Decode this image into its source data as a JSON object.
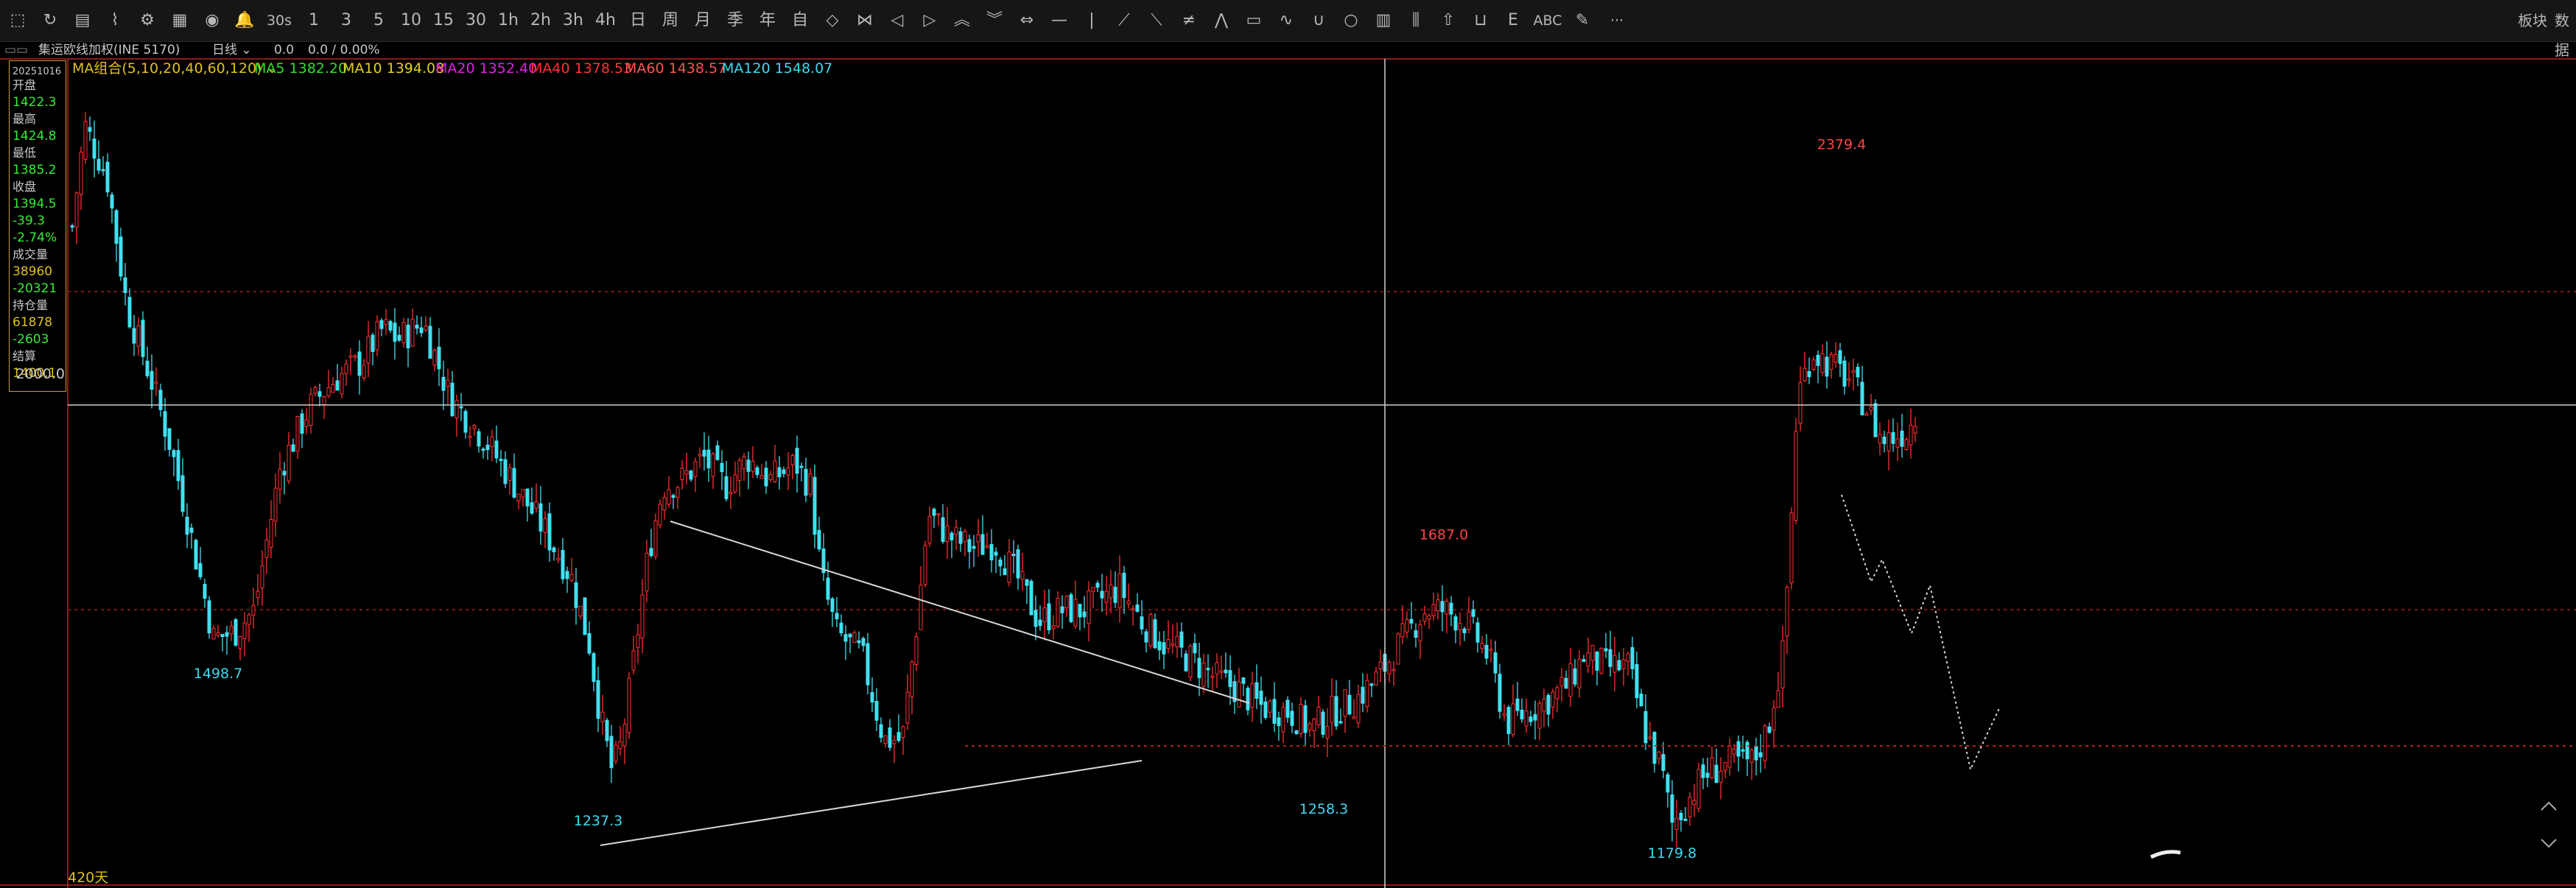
{
  "toolbar": {
    "left_items": [
      {
        "label": "⬚",
        "name": "draw-rect-icon"
      },
      {
        "label": "↻",
        "name": "refresh-icon"
      },
      {
        "label": "▤",
        "name": "list-icon"
      },
      {
        "label": "⌇",
        "name": "line-chart-icon"
      },
      {
        "label": "⚙",
        "name": "indicator-icon"
      },
      {
        "label": "▦",
        "name": "panel-icon"
      },
      {
        "label": "◉",
        "name": "overlay-icon"
      },
      {
        "label": "🔔",
        "name": "bell-icon"
      },
      {
        "label": "30s",
        "name": "period-30s"
      },
      {
        "label": "1",
        "name": "period-1m"
      },
      {
        "label": "3",
        "name": "period-3m"
      },
      {
        "label": "5",
        "name": "period-5m"
      },
      {
        "label": "10",
        "name": "period-10m"
      },
      {
        "label": "15",
        "name": "period-15m"
      },
      {
        "label": "30",
        "name": "period-30m"
      },
      {
        "label": "1h",
        "name": "period-1h"
      },
      {
        "label": "2h",
        "name": "period-2h"
      },
      {
        "label": "3h",
        "name": "period-3h"
      },
      {
        "label": "4h",
        "name": "period-4h"
      },
      {
        "label": "日",
        "name": "period-day"
      },
      {
        "label": "周",
        "name": "period-week"
      },
      {
        "label": "月",
        "name": "period-month"
      },
      {
        "label": "季",
        "name": "period-quarter"
      },
      {
        "label": "年",
        "name": "period-year"
      },
      {
        "label": "自",
        "name": "period-custom"
      },
      {
        "label": "◇",
        "name": "diamond-icon"
      },
      {
        "label": "⋈",
        "name": "bowtie-icon"
      },
      {
        "label": "◁",
        "name": "arrow-left-icon"
      },
      {
        "label": "▷",
        "name": "arrow-right-icon"
      },
      {
        "label": "︽",
        "name": "zoom-in-icon"
      },
      {
        "label": "︾",
        "name": "zoom-out-icon"
      },
      {
        "label": "⇔",
        "name": "fit-icon"
      },
      {
        "label": "—",
        "name": "hline-tool-icon"
      },
      {
        "label": "|",
        "name": "vline-tool-icon"
      },
      {
        "label": "⟋",
        "name": "trendline-tool-icon"
      },
      {
        "label": "⟍",
        "name": "ray-tool-icon"
      },
      {
        "label": "≠",
        "name": "parallel-tool-icon"
      },
      {
        "label": "⋀",
        "name": "zigzag-tool-icon"
      },
      {
        "label": "▭",
        "name": "rect-tool-icon"
      },
      {
        "label": "∿",
        "name": "wave-tool-icon"
      },
      {
        "label": "∪",
        "name": "arc-tool-icon"
      },
      {
        "label": "○",
        "name": "circle-tool-icon"
      },
      {
        "label": "▥",
        "name": "fib-tool-icon"
      },
      {
        "label": "⫼",
        "name": "gann-tool-icon"
      },
      {
        "label": "⇧",
        "name": "up-arrow-tool-icon"
      },
      {
        "label": "⊔",
        "name": "box-tool-icon"
      },
      {
        "label": "Ε",
        "name": "fan-tool-icon"
      },
      {
        "label": "ABC",
        "name": "text-tool-icon"
      },
      {
        "label": "✎",
        "name": "pen-tool-icon"
      },
      {
        "label": "···",
        "name": "more-icon"
      }
    ],
    "right_items": [
      "板块",
      "数据"
    ]
  },
  "info": {
    "symbol": "集运欧线加权(INE 5170)",
    "period": "日线",
    "change": "0.0",
    "change_pct": "0.0 / 0.00%"
  },
  "ma": {
    "group": "MA组合(5,10,20,40,60,120)",
    "items": [
      {
        "label": "MA5 1382.20",
        "color": "#33dd33"
      },
      {
        "label": "MA10 1394.08",
        "color": "#e0d020"
      },
      {
        "label": "MA20 1352.40",
        "color": "#e020e0"
      },
      {
        "label": "MA40 1378.53",
        "color": "#ff3333"
      },
      {
        "label": "MA60 1438.57",
        "color": "#ff5555"
      },
      {
        "label": "MA120 1548.07",
        "color": "#40d8f0"
      }
    ]
  },
  "quote_panel": {
    "date": "20251016",
    "rows": [
      {
        "label": "开盘",
        "value": "1422.3",
        "color": "#33ee33"
      },
      {
        "label": "最高",
        "value": "1424.8",
        "color": "#33ee33"
      },
      {
        "label": "最低",
        "value": "1385.2",
        "color": "#33ee33"
      },
      {
        "label": "收盘",
        "value": "1394.5",
        "color": "#33ee33"
      },
      {
        "label": "",
        "value": "-39.3",
        "color": "#33ee33"
      },
      {
        "label": "",
        "value": "-2.74%",
        "color": "#33ee33"
      },
      {
        "label": "成交量",
        "value": "38960",
        "color": "#e0c020"
      },
      {
        "label": "",
        "value": "-20321",
        "color": "#33ee33"
      },
      {
        "label": "持仓量",
        "value": "61878",
        "color": "#e0c020"
      },
      {
        "label": "",
        "value": "-2603",
        "color": "#33ee33"
      },
      {
        "label": "结算",
        "value": "1400.1",
        "color": "#e0c020"
      }
    ]
  },
  "chart_data": {
    "type": "candlestick",
    "y_axis_label": "2000.0",
    "ylim": [
      1100,
      2550
    ],
    "bars_label": "420天",
    "annotations": [
      {
        "text": "1498.7",
        "value": 1498.7,
        "color": "#40d8f0",
        "placement": "below"
      },
      {
        "text": "1237.3",
        "value": 1237.3,
        "color": "#40d8f0",
        "placement": "below"
      },
      {
        "text": "1258.3",
        "value": 1258.3,
        "color": "#40d8f0",
        "placement": "below"
      },
      {
        "text": "1687.0",
        "value": 1687.0,
        "color": "#ff4444",
        "placement": "above"
      },
      {
        "text": "1179.8",
        "value": 1179.8,
        "color": "#40d8f0",
        "placement": "below"
      },
      {
        "text": "2379.4",
        "value": 2379.4,
        "color": "#ff4444",
        "placement": "above"
      }
    ],
    "candle_up_color": "#ff3030",
    "candle_down_color": "#40e0f0",
    "grid": "dashed-red-horizontal"
  }
}
